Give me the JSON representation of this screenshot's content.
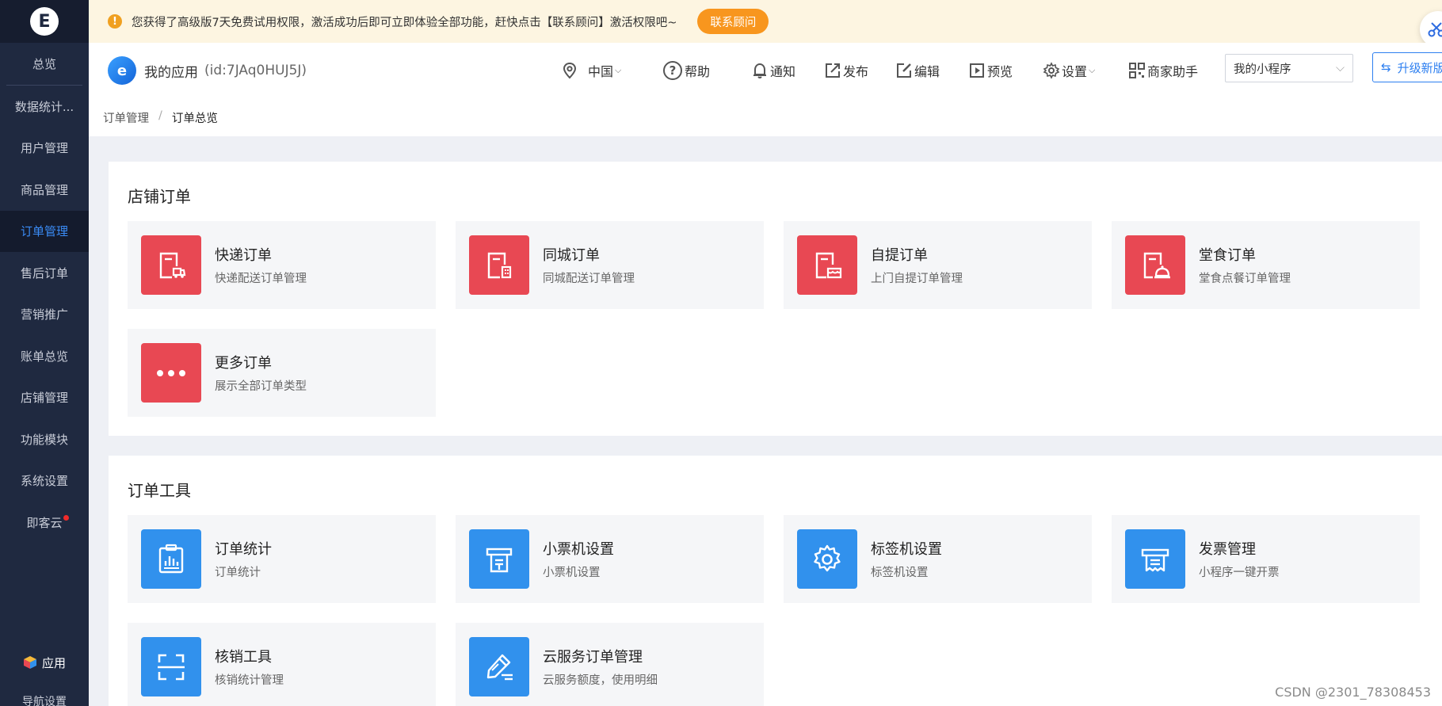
{
  "sidebar": {
    "logo": "E",
    "items": [
      {
        "label": "总览",
        "active": false
      },
      {
        "label": "数据统计...",
        "active": false
      },
      {
        "label": "用户管理",
        "active": false
      },
      {
        "label": "商品管理",
        "active": false
      },
      {
        "label": "订单管理",
        "active": true
      },
      {
        "label": "售后订单",
        "active": false
      },
      {
        "label": "营销推广",
        "active": false
      },
      {
        "label": "账单总览",
        "active": false
      },
      {
        "label": "店铺管理",
        "active": false
      },
      {
        "label": "功能模块",
        "active": false
      },
      {
        "label": "系统设置",
        "active": false
      },
      {
        "label": "即客云",
        "active": false,
        "badge_dot": true
      }
    ],
    "apps_label": "应用",
    "partial_item": "导航设置"
  },
  "notice": {
    "text": "您获得了高级版7天免费试用权限，激活成功后即可立即体验全部功能，赶快点击【联系顾问】激活权限吧~",
    "button": "联系顾问"
  },
  "header": {
    "app_name": "我的应用",
    "app_id": "(id:7JAq0HUJ5J)",
    "region": "中国",
    "tools": {
      "help": "帮助",
      "notify": "通知",
      "publish": "发布",
      "edit": "编辑",
      "preview": "预览",
      "settings": "设置",
      "merchant": "商家助手"
    },
    "mini_select": "我的小程序",
    "upgrade": "升级新版"
  },
  "breadcrumb": [
    "订单管理",
    "订单总览"
  ],
  "store_orders": {
    "title": "店铺订单",
    "cards": [
      {
        "title": "快递订单",
        "desc": "快递配送订单管理",
        "icon": "delivery-truck-icon"
      },
      {
        "title": "同城订单",
        "desc": "同城配送订单管理",
        "icon": "city-building-icon"
      },
      {
        "title": "自提订单",
        "desc": "上门自提订单管理",
        "icon": "store-pickup-icon"
      },
      {
        "title": "堂食订单",
        "desc": "堂食点餐订单管理",
        "icon": "dining-cloche-icon"
      },
      {
        "title": "更多订单",
        "desc": "展示全部订单类型",
        "icon": "more-dots-icon"
      }
    ]
  },
  "order_tools": {
    "title": "订单工具",
    "cards": [
      {
        "title": "订单统计",
        "desc": "订单统计",
        "icon": "stats-clipboard-icon"
      },
      {
        "title": "小票机设置",
        "desc": "小票机设置",
        "icon": "receipt-printer-icon"
      },
      {
        "title": "标签机设置",
        "desc": "标签机设置",
        "icon": "gear-icon"
      },
      {
        "title": "发票管理",
        "desc": "小程序一键开票",
        "icon": "invoice-icon"
      },
      {
        "title": "核销工具",
        "desc": "核销统计管理",
        "icon": "scan-icon"
      },
      {
        "title": "云服务订单管理",
        "desc": "云服务额度，使用明细",
        "icon": "cloud-edit-icon"
      }
    ]
  },
  "watermark": "CSDN @2301_78308453"
}
